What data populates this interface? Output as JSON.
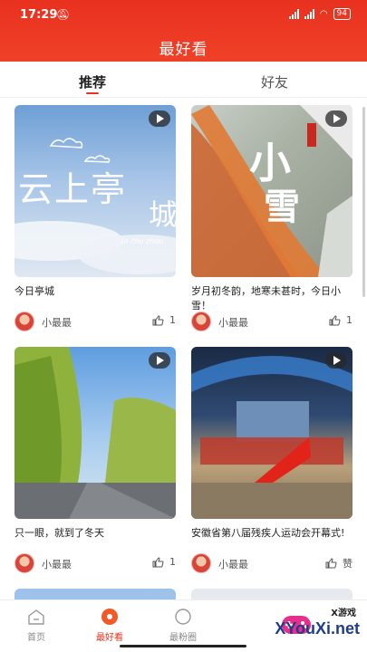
{
  "status_bar": {
    "time": "17:29",
    "battery": "94"
  },
  "header": {
    "title": "最好看"
  },
  "tabs": [
    {
      "label": "推荐",
      "active": true
    },
    {
      "label": "好友",
      "active": false
    }
  ],
  "cards": [
    {
      "title": "今日亭城",
      "author": "小最最",
      "likes": "1",
      "thumb_text_1": "云上亭",
      "thumb_text_2": "城",
      "thumb_sub": "in chu zhou"
    },
    {
      "title": "岁月初冬韵，地寒未甚时，今日小雪！",
      "author": "小最最",
      "likes": "1",
      "thumb_text_1": "小",
      "thumb_text_2": "雪"
    },
    {
      "title": "只一眼，就到了冬天",
      "author": "小最最",
      "likes": "1"
    },
    {
      "title": "安徽省第八届残疾人运动会开幕式!",
      "author": "小最最",
      "likes": "赞"
    }
  ],
  "bottom_nav": [
    {
      "label": "首页",
      "icon": "home-icon",
      "active": false
    },
    {
      "label": "最好看",
      "icon": "play-circle-icon",
      "active": true
    },
    {
      "label": "最粉圈",
      "icon": "circle-icon",
      "active": false
    }
  ],
  "watermark": {
    "site": "XYouXi.net",
    "tag": "X游戏"
  },
  "colors": {
    "accent": "#e8311f",
    "header": "#ef3b25"
  }
}
